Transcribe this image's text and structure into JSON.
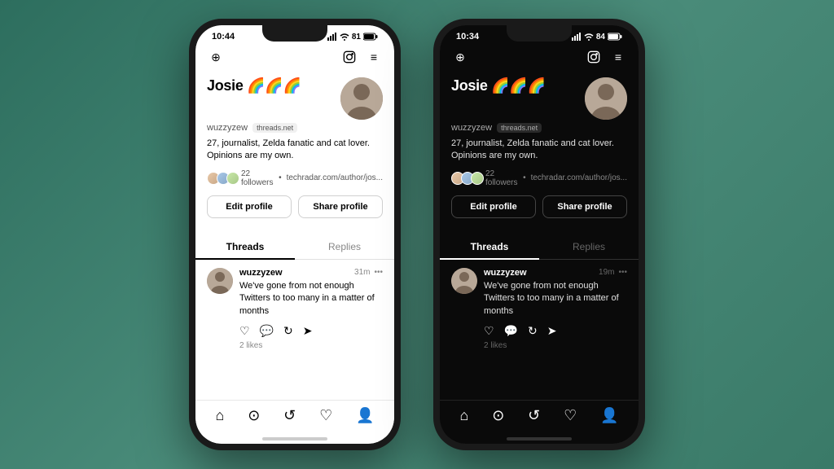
{
  "phones": [
    {
      "id": "light-phone",
      "theme": "light",
      "status_bar": {
        "time": "10:44",
        "battery": "81"
      },
      "profile": {
        "name": "Josie 🌈🌈🌈",
        "username": "wuzzyzew",
        "domain": "threads.net",
        "bio": "27, journalist, Zelda fanatic and cat lover.\nOpinions are my own.",
        "followers_count": "22 followers",
        "followers_link": "techradar.com/author/jos...",
        "edit_button": "Edit profile",
        "share_button": "Share profile"
      },
      "tabs": {
        "threads_label": "Threads",
        "replies_label": "Replies"
      },
      "post": {
        "username": "wuzzyzew",
        "time": "31m",
        "text": "We've gone from not enough Twitters to too many in a matter of months",
        "likes": "2 likes"
      },
      "bottom_nav": [
        "home",
        "search",
        "refresh",
        "heart",
        "person"
      ]
    },
    {
      "id": "dark-phone",
      "theme": "dark",
      "status_bar": {
        "time": "10:34",
        "battery": "84"
      },
      "profile": {
        "name": "Josie 🌈🌈🌈",
        "username": "wuzzyzew",
        "domain": "threads.net",
        "bio": "27, journalist, Zelda fanatic and cat lover.\nOpinions are my own.",
        "followers_count": "22 followers",
        "followers_link": "techradar.com/author/jos...",
        "edit_button": "Edit profile",
        "share_button": "Share profile"
      },
      "tabs": {
        "threads_label": "Threads",
        "replies_label": "Replies"
      },
      "post": {
        "username": "wuzzyzew",
        "time": "19m",
        "text": "We've gone from not enough Twitters to too many in a matter of months",
        "likes": "2 likes"
      },
      "bottom_nav": [
        "home",
        "search",
        "refresh",
        "heart",
        "person"
      ]
    }
  ]
}
